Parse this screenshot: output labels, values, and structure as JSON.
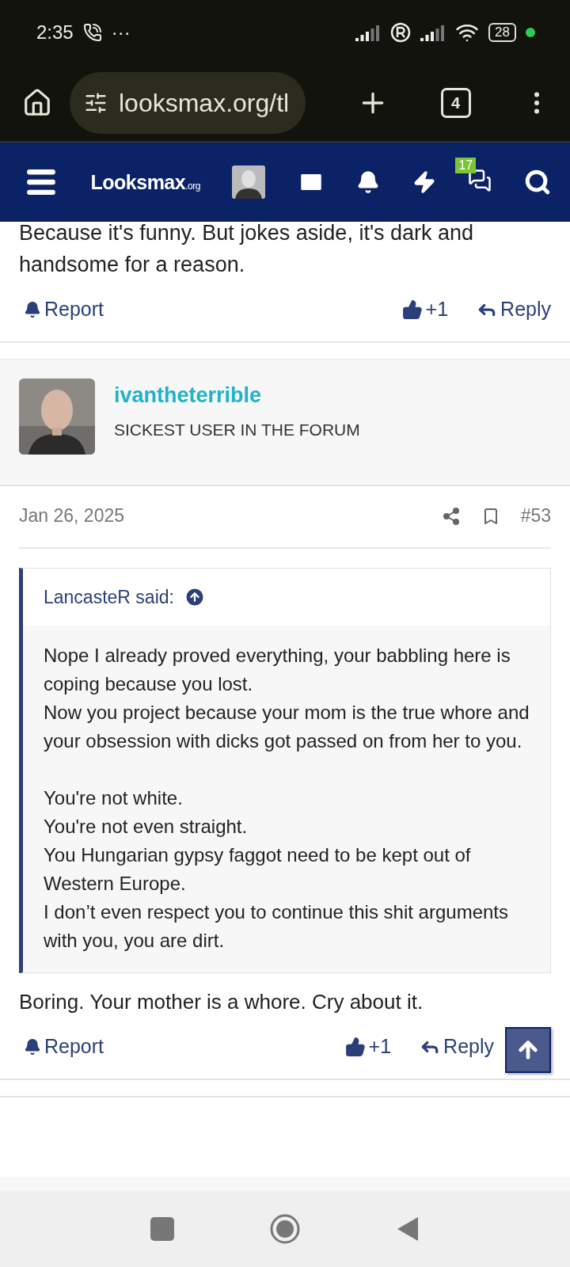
{
  "status_bar": {
    "time": "2:35",
    "more": "···",
    "battery": "28"
  },
  "browser": {
    "url": "looksmax.org/tl",
    "tab_count": "4"
  },
  "site_nav": {
    "logo": "Looksmax",
    "logo_suffix": ".org",
    "notification_count": "17"
  },
  "previous_post": {
    "body_lines": [
      "Because it's funny. But jokes aside, it's dark and handsome for a reason."
    ],
    "actions": {
      "report": "Report",
      "likes": "+1",
      "reply": "Reply"
    }
  },
  "post": {
    "user": {
      "name": "ivantheterrible",
      "title": "SICKEST USER IN THE FORUM"
    },
    "date": "Jan 26, 2025",
    "number": "#53",
    "quote": {
      "author": "LancasteR said:",
      "paragraphs": [
        [
          "Nope I already proved everything, your babbling here is coping because you lost.",
          "Now you project because your mom is the true whore and your obsession with dicks got passed on from her to you."
        ],
        [
          "You're not white.",
          "You're not even straight.",
          "You Hungarian gypsy faggot need to be kept out of Western Europe.",
          "I don’t even respect you to continue this shit arguments with you, you are dirt."
        ]
      ]
    },
    "body": "Boring. Your mother is a whore. Cry about it.",
    "actions": {
      "report": "Report",
      "likes": "+1",
      "reply": "Reply"
    }
  }
}
